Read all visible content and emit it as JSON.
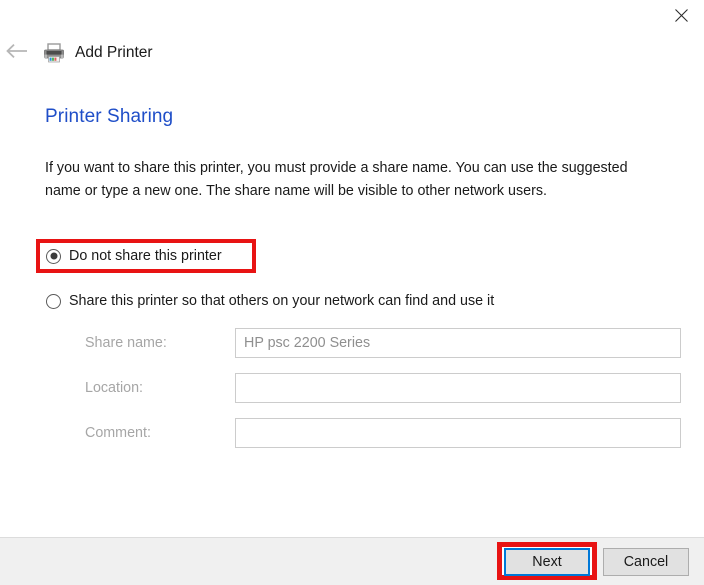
{
  "window": {
    "close_label": "close-icon"
  },
  "header": {
    "back_label": "back-arrow-icon",
    "printer_icon": "printer-icon",
    "title": "Add Printer"
  },
  "page": {
    "heading": "Printer Sharing",
    "description": "If you want to share this printer, you must provide a share name. You can use the suggested name or type a new one. The share name will be visible to other network users."
  },
  "sharing_options": {
    "selected": "do_not_share",
    "items": [
      {
        "id": "do_not_share",
        "label": "Do not share this printer",
        "checked": true,
        "highlighted": true
      },
      {
        "id": "share",
        "label": "Share this printer so that others on your network can find and use it",
        "checked": false,
        "highlighted": false
      }
    ]
  },
  "form": {
    "fields": [
      {
        "label": "Share name:",
        "value": "HP psc 2200 Series",
        "placeholder": "",
        "disabled": true
      },
      {
        "label": "Location:",
        "value": "",
        "placeholder": "",
        "disabled": true
      },
      {
        "label": "Comment:",
        "value": "",
        "placeholder": "",
        "disabled": true
      }
    ]
  },
  "footer": {
    "next_label": "Next",
    "cancel_label": "Cancel"
  },
  "colors": {
    "heading_blue": "#1f4ec8",
    "highlight_red": "#e81313",
    "focus_blue": "#0078d7",
    "footer_bg": "#f0f0f0",
    "disabled_text": "#a6a6a6"
  }
}
